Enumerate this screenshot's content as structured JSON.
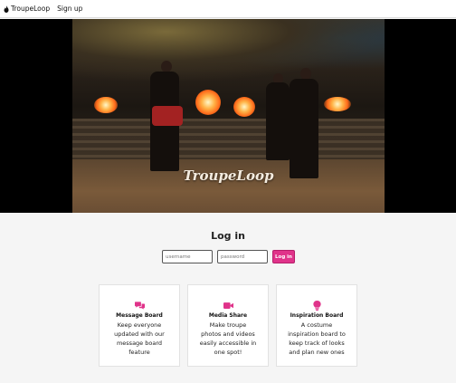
{
  "nav": {
    "brand": "TroupeLoop",
    "brand_icon": "flame-icon",
    "signup": "Sign up"
  },
  "hero": {
    "watermark": "TroupeLoop"
  },
  "login": {
    "title": "Log in",
    "username_placeholder": "username",
    "password_placeholder": "password",
    "button": "Log in"
  },
  "features": [
    {
      "icon": "chat-bubbles-icon",
      "title": "Message Board",
      "description": "Keep everyone updated with our message board feature"
    },
    {
      "icon": "video-camera-icon",
      "title": "Media Share",
      "description": "Make troupe photos and videos easily accessible in one spot!"
    },
    {
      "icon": "lightbulb-icon",
      "title": "Inspiration Board",
      "description": "A costume inspiration board to keep track of looks and plan new ones"
    }
  ],
  "colors": {
    "accent": "#e0338a",
    "page_background": "#f5f5f5",
    "hero_background": "#000000"
  }
}
